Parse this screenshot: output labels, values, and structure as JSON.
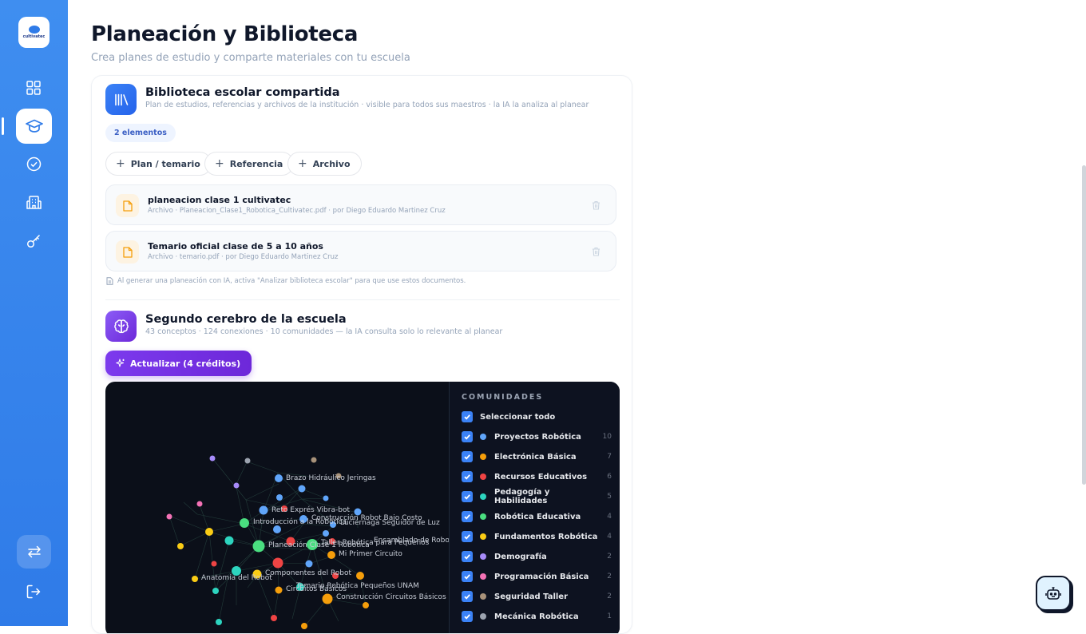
{
  "app": {
    "logo_text": "cultivatec"
  },
  "header": {
    "title": "Planeación y Biblioteca",
    "subtitle": "Crea planes de estudio y comparte materiales con tu escuela"
  },
  "library": {
    "title": "Biblioteca escolar compartida",
    "subtitle": "Plan de estudios, referencias y archivos de la institución · visible para todos sus maestros · la IA la analiza al planear",
    "count_badge": "2 elementos",
    "buttons": {
      "plan": "Plan / temario",
      "referencia": "Referencia",
      "archivo": "Archivo"
    },
    "files": [
      {
        "name": "planeacion clase 1 cultivatec",
        "meta": "Archivo · Planeacion_Clase1_Robotica_Cultivatec.pdf · por Diego Eduardo Martinez Cruz"
      },
      {
        "name": "Temario oficial clase de 5 a 10 años",
        "meta": "Archivo · temario.pdf · por Diego Eduardo Martinez Cruz"
      }
    ],
    "hint": "Al generar una planeación con IA, activa \"Analizar biblioteca escolar\" para que use estos documentos."
  },
  "brain": {
    "title": "Segundo cerebro de la escuela",
    "subtitle": "43 conceptos · 124 conexiones · 10 comunidades — la IA consulta solo lo relevante al planear",
    "refresh_button": "Actualizar (4 créditos)"
  },
  "graph": {
    "labels": {
      "l1": "Brazo Hidráulico Jeringas",
      "l2": "Reto Exprés Vibra-bot",
      "l3": "Construcción Robot Bajo Costo",
      "l4": "Introducción a la Robótica",
      "l5": "Luciérnaga Seguidor de Luz",
      "l6": "Ensamblado de Robo",
      "l7": "Planeación Clase 1 Robótica",
      "l8": "Taller Robótica para Pequeños",
      "l9": "Mi Primer Circuito",
      "l10": "Componentes del Robot",
      "l11": "Anatomía del Robot",
      "l12": "Temario Robótica Pequeños UNAM",
      "l13": "Circuitos Básicos",
      "l14": "Construcción Circuitos Básicos"
    }
  },
  "communities": {
    "title": "COMUNIDADES",
    "select_all": "Seleccionar todo",
    "items": [
      {
        "name": "Proyectos Robótica",
        "count": "10",
        "color": "#60a5fa"
      },
      {
        "name": "Electrónica Básica",
        "count": "7",
        "color": "#f59e0b"
      },
      {
        "name": "Recursos Educativos",
        "count": "6",
        "color": "#ef4444"
      },
      {
        "name": "Pedagogía y Habilidades",
        "count": "5",
        "color": "#2dd4bf"
      },
      {
        "name": "Robótica Educativa",
        "count": "4",
        "color": "#4ade80"
      },
      {
        "name": "Fundamentos Robótica",
        "count": "4",
        "color": "#facc15"
      },
      {
        "name": "Demografía",
        "count": "2",
        "color": "#a78bfa"
      },
      {
        "name": "Programación Básica",
        "count": "2",
        "color": "#f472b6"
      },
      {
        "name": "Seguridad Taller",
        "count": "2",
        "color": "#a8927a"
      },
      {
        "name": "Mecánica Robótica",
        "count": "1",
        "color": "#9ca3af"
      }
    ]
  }
}
